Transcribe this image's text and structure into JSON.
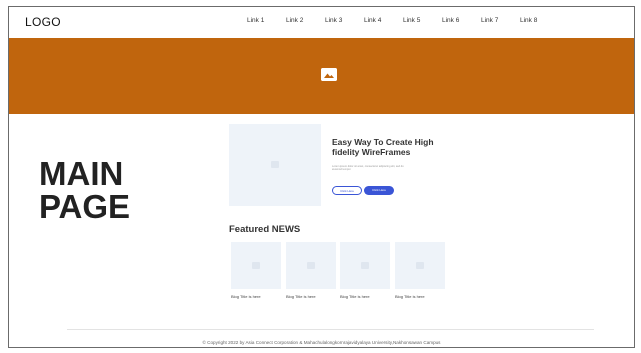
{
  "header": {
    "logo": "LOGO",
    "nav": [
      "Link 1",
      "Link 2",
      "Link 3",
      "Link 4",
      "Link 5",
      "Link 6",
      "Link 7",
      "Link 8"
    ]
  },
  "hero": {
    "image_icon": "image-placeholder-icon",
    "color": "#c0650d"
  },
  "main": {
    "title_line1": "MAIN",
    "title_line2": "PAGE"
  },
  "card": {
    "title": "Easy Way To Create High fidelity WireFrames",
    "description": "Lorem ipsum dolor sit amet, consectetur adipiscing elit, sed do eiusmod tempor.",
    "button_secondary": "Click Here",
    "button_primary": "Click Here",
    "accent": "#3a55d6"
  },
  "featured": {
    "title": "Featured NEWS",
    "items": [
      {
        "title": "Blog Title is here"
      },
      {
        "title": "Blog Title is here"
      },
      {
        "title": "Blog Title is here"
      },
      {
        "title": "Blog Title is here"
      }
    ]
  },
  "footer": {
    "text": "© Copyright 2022 by Asia Connect Corporation & Mahachulalongkornrajavidyalaya University,Nakhonsawan Campus"
  }
}
